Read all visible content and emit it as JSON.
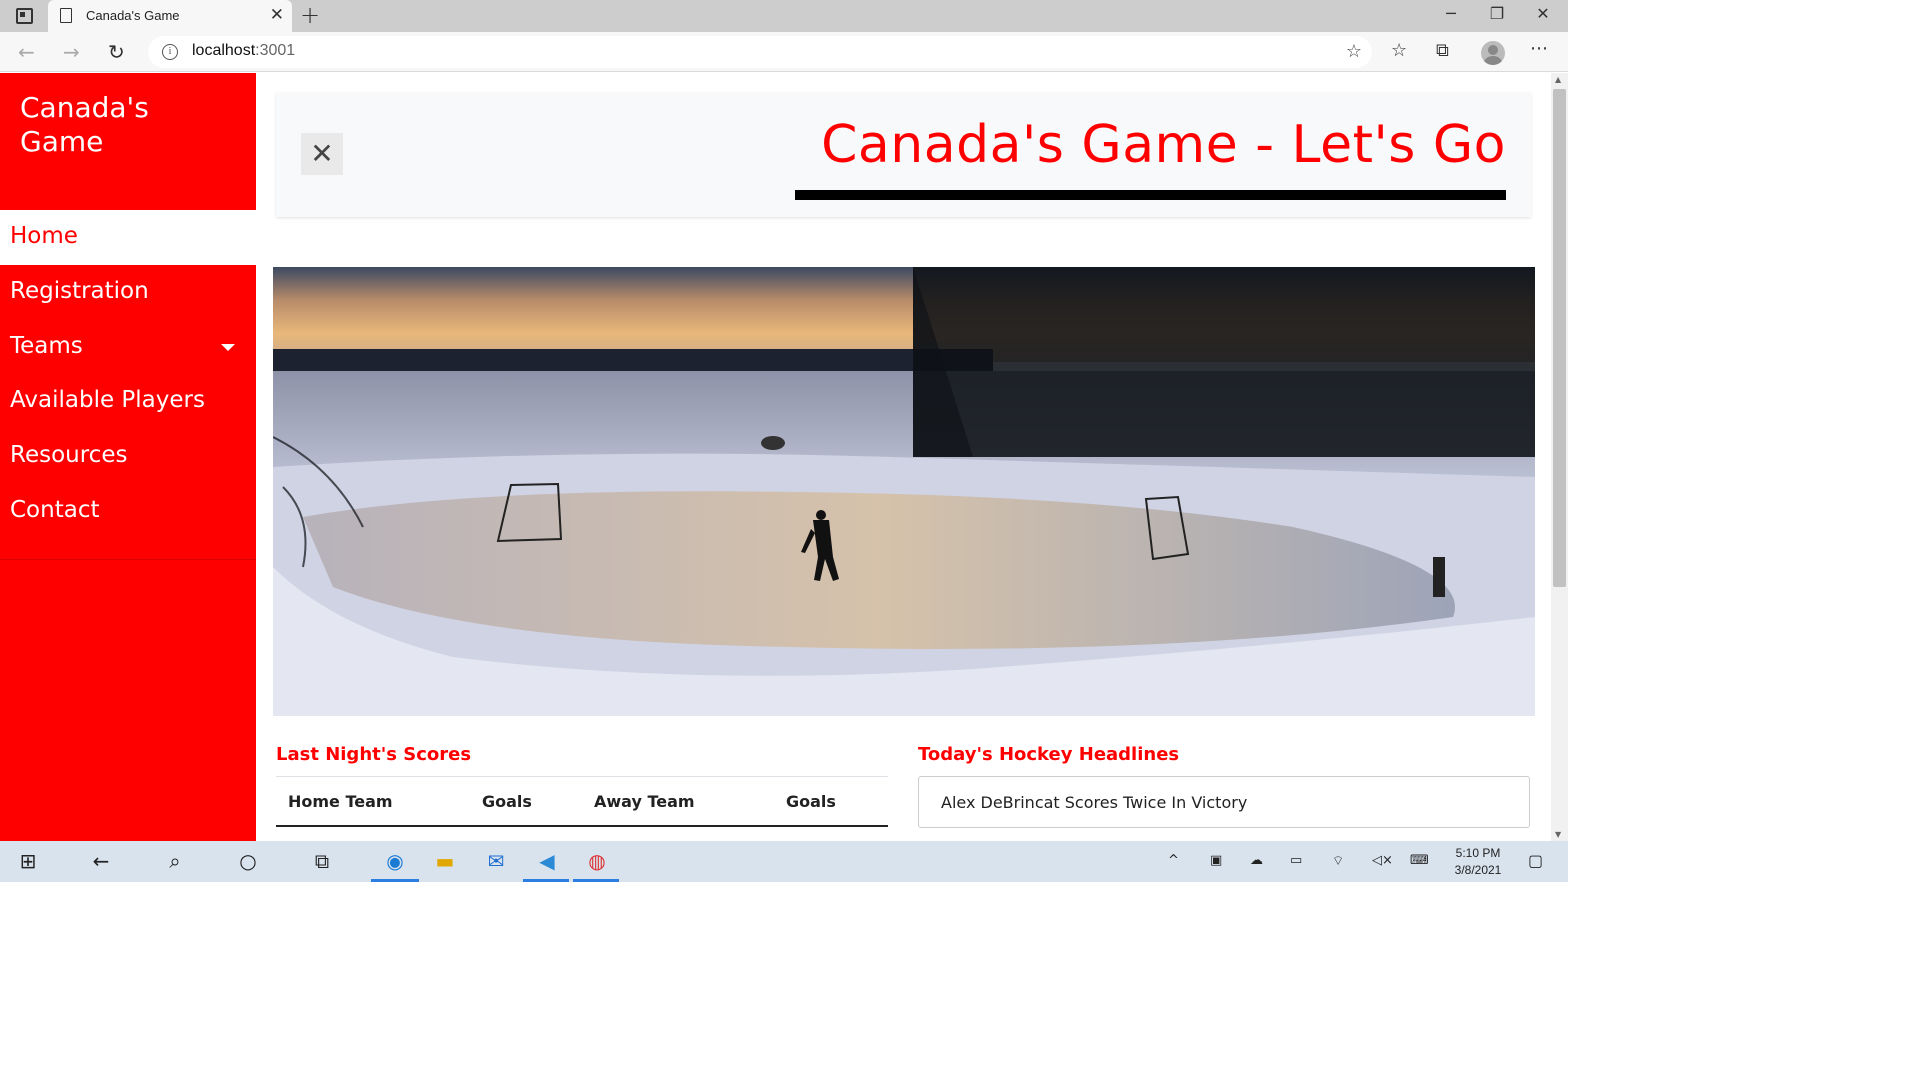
{
  "browser": {
    "tab_title": "Canada's Game",
    "tab_close": "✕",
    "new_tab": "+",
    "url_host": "localhost",
    "url_port": ":3001",
    "minimize": "─",
    "restore": "❐",
    "close": "✕"
  },
  "sidebar": {
    "brand": "Canada's Game",
    "items": [
      {
        "label": "Home",
        "active": true
      },
      {
        "label": "Registration"
      },
      {
        "label": "Teams",
        "has_dropdown": true
      },
      {
        "label": "Available Players"
      },
      {
        "label": "Resources"
      },
      {
        "label": "Contact"
      }
    ]
  },
  "header": {
    "close_symbol": "✕",
    "title": "Canada's Game - Let's Go"
  },
  "hero": {
    "alt": "Pond hockey at sunset"
  },
  "scores": {
    "title": "Last Night's Scores",
    "columns": [
      "Home Team",
      "Goals",
      "Away Team",
      "Goals"
    ]
  },
  "headlines": {
    "title": "Today's Hockey Headlines",
    "items": [
      "Alex DeBrincat Scores Twice In Victory"
    ]
  },
  "taskbar": {
    "time": "5:10 PM",
    "date": "3/8/2021"
  },
  "colors": {
    "brand_red": "#ff0000",
    "sidebar_bg": "#ff0000",
    "text_dark": "#222222"
  }
}
